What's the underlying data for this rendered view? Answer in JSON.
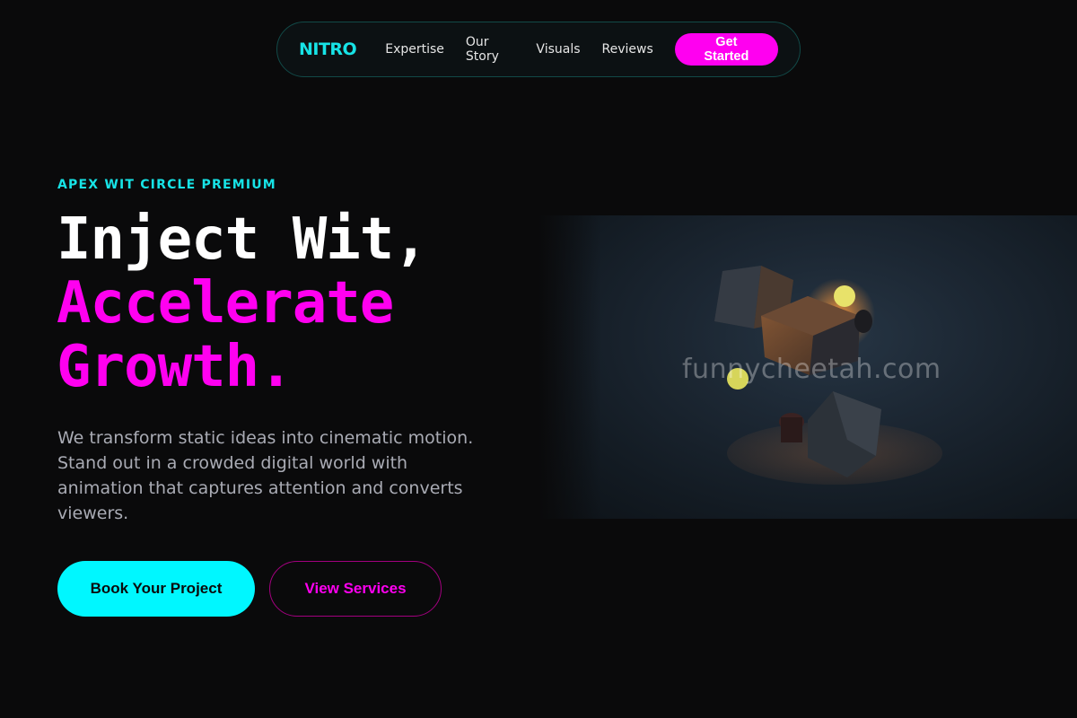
{
  "nav": {
    "logo": "NITRO",
    "links": [
      "Expertise",
      "Our Story",
      "Visuals",
      "Reviews"
    ],
    "cta": "Get Started"
  },
  "hero": {
    "eyebrow": "APEX WIT CIRCLE PREMIUM",
    "headline_line1": "Inject Wit,",
    "headline_line2": "Accelerate",
    "headline_line3": "Growth.",
    "lead": "We transform static ideas into cinematic motion. Stand out in a crowded digital world with animation that captures attention and converts viewers.",
    "primary_button": "Book Your Project",
    "secondary_button": "View Services"
  },
  "image": {
    "watermark": "funnycheetah.com"
  },
  "colors": {
    "accent_cyan": "#00f7ff",
    "accent_magenta": "#ff00f0",
    "background": "#0a0a0b"
  }
}
